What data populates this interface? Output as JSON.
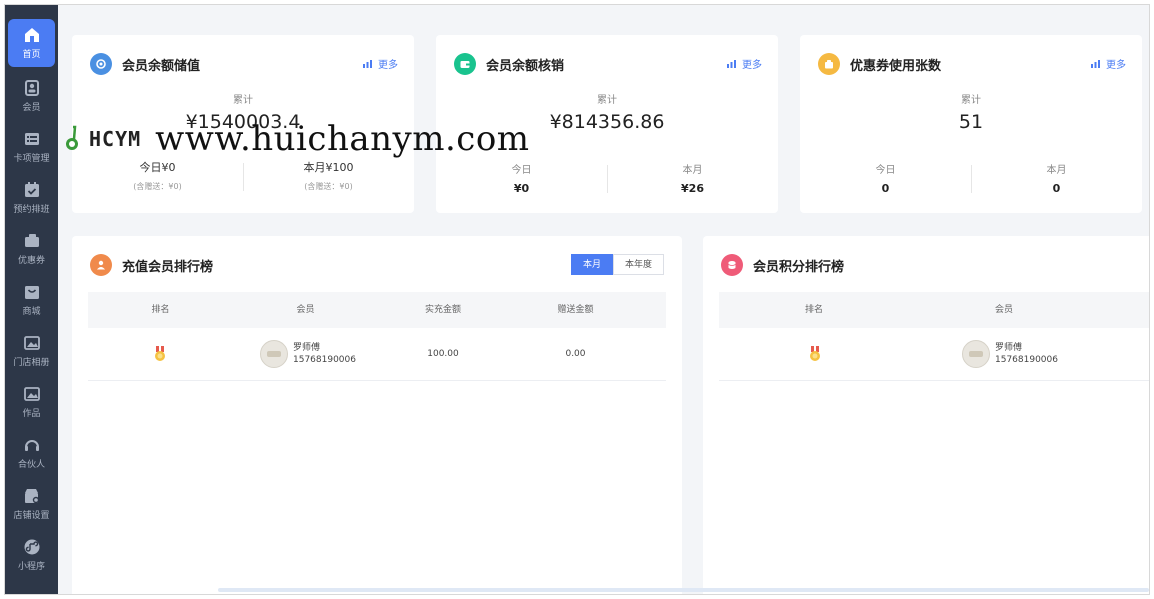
{
  "sidebar": {
    "items": [
      {
        "label": "首页",
        "icon": "home-icon"
      },
      {
        "label": "会员",
        "icon": "member-icon"
      },
      {
        "label": "卡项管理",
        "icon": "card-icon"
      },
      {
        "label": "预约排班",
        "icon": "calendar-icon"
      },
      {
        "label": "优惠券",
        "icon": "coupon-icon"
      },
      {
        "label": "商城",
        "icon": "mall-icon"
      },
      {
        "label": "门店相册",
        "icon": "album-icon"
      },
      {
        "label": "作品",
        "icon": "works-icon"
      },
      {
        "label": "合伙人",
        "icon": "partner-icon"
      },
      {
        "label": "店铺设置",
        "icon": "store-settings-icon"
      },
      {
        "label": "小程序",
        "icon": "miniprogram-icon"
      }
    ]
  },
  "cards": {
    "stored_value": {
      "title": "会员余额储值",
      "more": "更多",
      "cumulative_label": "累计",
      "cumulative_value": "¥1540003.4",
      "today": "今日¥0",
      "today_note": "(含赠送：¥0)",
      "month": "本月¥100",
      "month_note": "(含赠送：¥0)",
      "accent": "#4a90e2"
    },
    "write_off": {
      "title": "会员余额核销",
      "more": "更多",
      "cumulative_label": "累计",
      "cumulative_value": "¥814356.86",
      "today_label": "今日",
      "today_value": "¥0",
      "month_label": "本月",
      "month_value": "¥26",
      "accent": "#19c38e"
    },
    "coupons": {
      "title": "优惠券使用张数",
      "more": "更多",
      "cumulative_label": "累计",
      "cumulative_value": "51",
      "today_label": "今日",
      "today_value": "0",
      "month_label": "本月",
      "month_value": "0",
      "accent": "#f5b942"
    }
  },
  "recharge_rank": {
    "title": "充值会员排行榜",
    "tabs": [
      "本月",
      "本年度"
    ],
    "columns": [
      "排名",
      "会员",
      "实充金额",
      "赠送金额"
    ],
    "rows": [
      {
        "name": "罗师傅",
        "phone": "15768190006",
        "paid": "100.00",
        "bonus": "0.00"
      }
    ],
    "accent": "#f08a4b"
  },
  "points_rank": {
    "title": "会员积分排行榜",
    "columns": [
      "排名",
      "会员"
    ],
    "rows": [
      {
        "name": "罗师傅",
        "phone": "15768190006"
      }
    ],
    "accent": "#ef5b78"
  },
  "watermark": {
    "brand": "HCYM",
    "url": "www.huichanym.com"
  }
}
